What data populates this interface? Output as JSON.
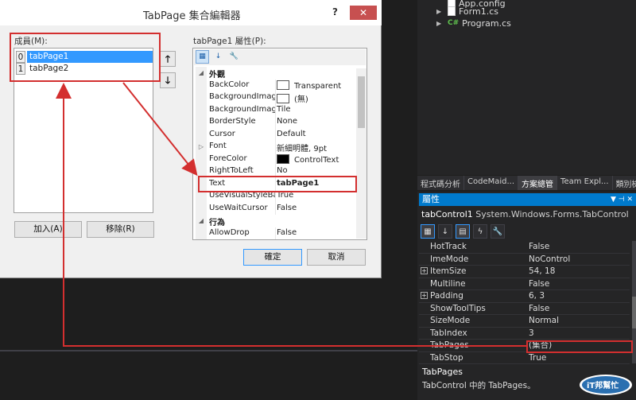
{
  "solution_tree": {
    "items": [
      {
        "label": "App.config"
      },
      {
        "label": "Form1.cs"
      },
      {
        "label": "Program.cs"
      }
    ]
  },
  "vs_tabs": [
    "程式碼分析",
    "CodeMaid...",
    "方案總管",
    "Team Expl...",
    "類別檢視"
  ],
  "properties_window": {
    "title": "屬性",
    "object_name": "tabControl1",
    "object_type": "System.Windows.Forms.TabControl",
    "rows": [
      {
        "name": "HotTrack",
        "value": "False",
        "expandable": false
      },
      {
        "name": "ImeMode",
        "value": "NoControl",
        "expandable": false
      },
      {
        "name": "ItemSize",
        "value": "54, 18",
        "expandable": true
      },
      {
        "name": "Multiline",
        "value": "False",
        "expandable": false
      },
      {
        "name": "Padding",
        "value": "6, 3",
        "expandable": true
      },
      {
        "name": "ShowToolTips",
        "value": "False",
        "expandable": false
      },
      {
        "name": "SizeMode",
        "value": "Normal",
        "expandable": false
      },
      {
        "name": "TabIndex",
        "value": "3",
        "expandable": false
      },
      {
        "name": "TabPages",
        "value": "(集合)",
        "expandable": false
      },
      {
        "name": "TabStop",
        "value": "True",
        "expandable": false
      }
    ],
    "description_title": "TabPages",
    "description_text": "TabControl 中的 TabPages。"
  },
  "dialog": {
    "title": "TabPage 集合編輯器",
    "help": "?",
    "close": "✕",
    "members_label": "成員(M):",
    "members": [
      {
        "index": "0",
        "name": "tabPage1",
        "selected": true
      },
      {
        "index": "1",
        "name": "tabPage2",
        "selected": false
      }
    ],
    "up_arrow": "🡑",
    "down_arrow": "🡓",
    "add_label": "加入(A)",
    "remove_label": "移除(R)",
    "props_label": "tabPage1 屬性(P):",
    "ok_label": "確定",
    "cancel_label": "取消",
    "grid": [
      {
        "type": "category",
        "name": "外觀"
      },
      {
        "name": "BackColor",
        "value": "Transparent",
        "swatch": "#ffffff"
      },
      {
        "name": "BackgroundImage",
        "value": "(無)",
        "swatch": "#ffffff"
      },
      {
        "name": "BackgroundImageLayout",
        "value": "Tile"
      },
      {
        "name": "BorderStyle",
        "value": "None"
      },
      {
        "name": "Cursor",
        "value": "Default"
      },
      {
        "name": "Font",
        "value": "新細明體, 9pt",
        "expander": "▷"
      },
      {
        "name": "ForeColor",
        "value": "ControlText",
        "swatch": "#000000"
      },
      {
        "name": "RightToLeft",
        "value": "No"
      },
      {
        "name": "Text",
        "value": "tabPage1",
        "bold": true
      },
      {
        "name": "UseVisualStyleBackColor",
        "value": "True"
      },
      {
        "name": "UseWaitCursor",
        "value": "False"
      },
      {
        "type": "category",
        "name": "行為"
      },
      {
        "name": "AllowDrop",
        "value": "False"
      }
    ]
  },
  "watermark": {
    "text": "iT邦幫忙"
  },
  "colors": {
    "accent": "#007acc",
    "annotation_red": "#d32f2f",
    "selection": "#3399ff"
  }
}
